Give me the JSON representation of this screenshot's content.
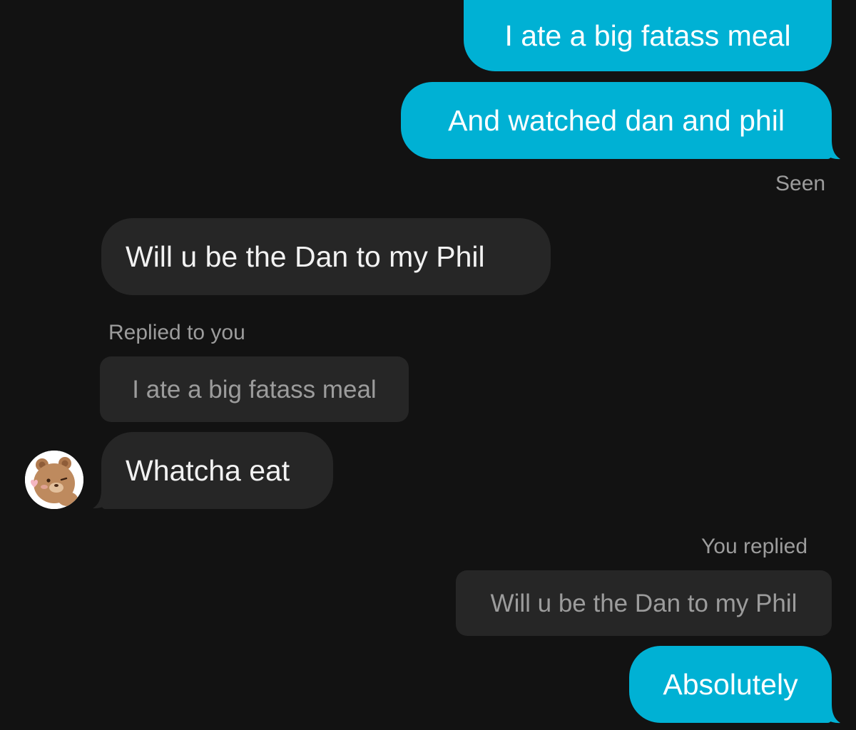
{
  "conversation": {
    "messages": [
      {
        "id": "m1",
        "direction": "outgoing",
        "text": "I ate a big fatass meal"
      },
      {
        "id": "m2",
        "direction": "outgoing",
        "text": "And watched dan and phil"
      },
      {
        "id": "m3",
        "direction": "incoming",
        "text": "Will u be the Dan to my Phil"
      },
      {
        "id": "m4",
        "direction": "incoming",
        "reply_label": "Replied to you",
        "quoted_text": "I ate a big fatass meal",
        "text": "Whatcha eat"
      },
      {
        "id": "m5",
        "direction": "outgoing",
        "reply_label": "You replied",
        "quoted_text": "Will u be the Dan to my Phil",
        "text": "Absolutely"
      }
    ],
    "seen_status": "Seen",
    "contact_avatar": "teddy-bear-avatar"
  },
  "colors": {
    "background": "#121212",
    "outgoing_bubble": "#00B1D4",
    "incoming_bubble": "#262626",
    "meta_text": "#9C9C9C"
  }
}
